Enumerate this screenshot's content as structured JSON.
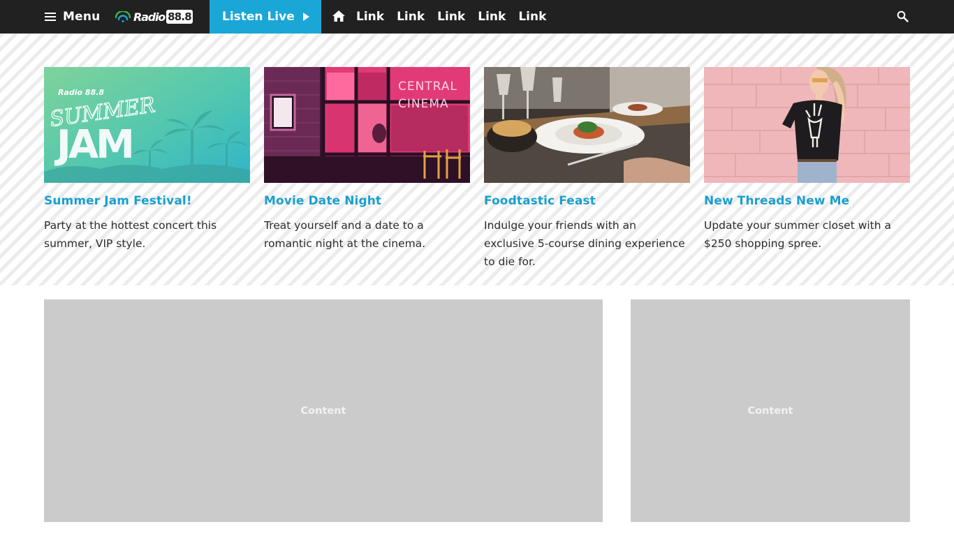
{
  "navbar": {
    "menu_label": "Menu",
    "logo_word": "Radio",
    "logo_freq": "88.8",
    "listen_label": "Listen Live",
    "links": [
      "Link",
      "Link",
      "Link",
      "Link",
      "Link"
    ]
  },
  "cards": [
    {
      "title": "Summer Jam Festival!",
      "desc": "Party at the hottest concert this summer, VIP style.",
      "image_logo_text": "Radio 88.8",
      "image_line1": "SUMMER",
      "image_line2": "JAM"
    },
    {
      "title": "Movie Date Night",
      "desc": "Treat yourself and a date to a romantic night at the cinema.",
      "image_sign_line1": "CENTRAL",
      "image_sign_line2": "CINEMA"
    },
    {
      "title": "Foodtastic Feast",
      "desc": "Indulge your friends with an exclusive 5-course dining experience to die for."
    },
    {
      "title": "New Threads New Me",
      "desc": "Update your summer closet with a $250 shopping spree."
    }
  ],
  "content": {
    "main_label": "Content",
    "side_label": "Content"
  },
  "colors": {
    "nav_bg": "#212121",
    "accent": "#1aa6d6",
    "title_blue": "#1a9fcf",
    "placeholder_gray": "#cbcbcb"
  }
}
